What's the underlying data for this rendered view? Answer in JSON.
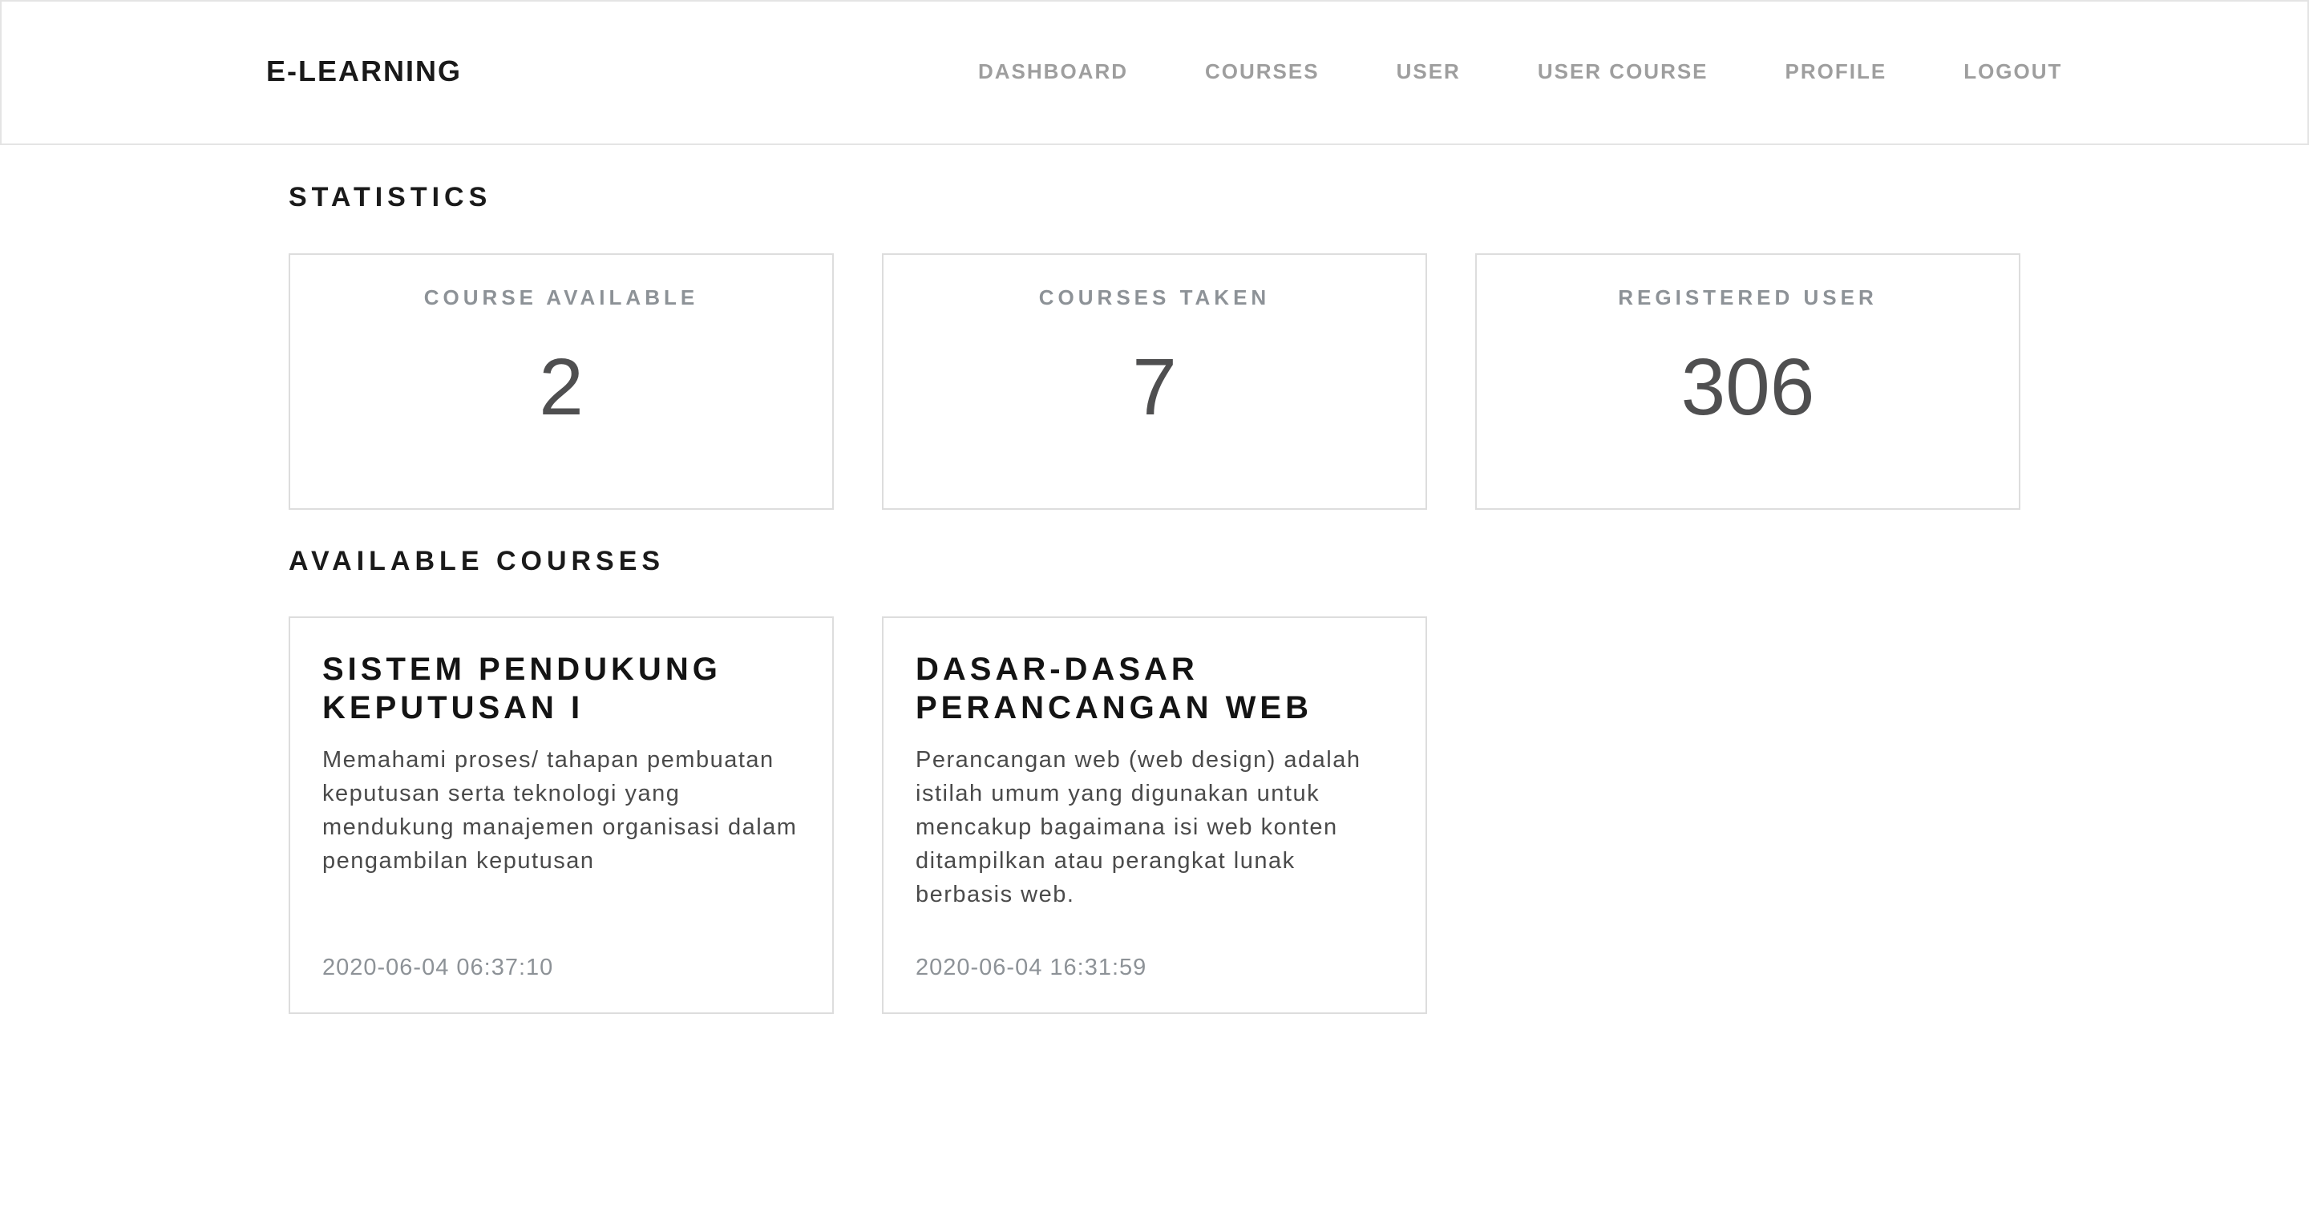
{
  "brand": "E-LEARNING",
  "nav": {
    "items": [
      {
        "label": "DASHBOARD"
      },
      {
        "label": "COURSES"
      },
      {
        "label": "USER"
      },
      {
        "label": "USER COURSE"
      },
      {
        "label": "PROFILE"
      },
      {
        "label": "LOGOUT"
      }
    ]
  },
  "statistics": {
    "title": "STATISTICS",
    "cards": [
      {
        "label": "COURSE AVAILABLE",
        "value": "2"
      },
      {
        "label": "COURSES TAKEN",
        "value": "7"
      },
      {
        "label": "REGISTERED USER",
        "value": "306"
      }
    ]
  },
  "available_courses": {
    "title": "AVAILABLE COURSES",
    "items": [
      {
        "title": "SISTEM PENDUKUNG KEPUTUSAN I",
        "description": "Memahami proses/ tahapan pembuatan keputusan serta teknologi yang mendukung manajemen organisasi dalam pengambilan keputusan",
        "date": "2020-06-04 06:37:10"
      },
      {
        "title": "DASAR-DASAR PERANCANGAN WEB",
        "description": "Perancangan web (web design) adalah istilah umum yang digunakan untuk mencakup bagaimana isi web konten ditampilkan atau perangkat lunak berbasis web.",
        "date": "2020-06-04 16:31:59"
      }
    ]
  }
}
